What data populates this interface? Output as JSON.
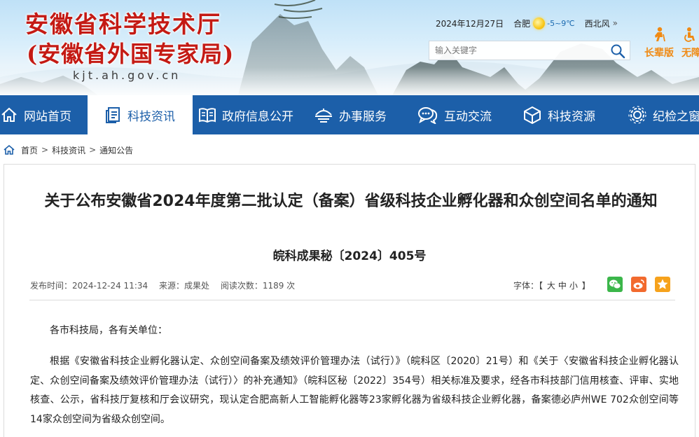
{
  "header": {
    "title": "安徽省科学技术厅",
    "subtitle": "(安徽省外国专家局)",
    "domain": "kjt.ah.gov.cn",
    "date": "2024年12月27日",
    "weather": {
      "city": "合肥",
      "temp": "-5~9℃",
      "wind": "西北风",
      "icon": "sun-icon"
    },
    "search": {
      "placeholder": "输入关键字"
    },
    "care_mode_label": "长辈版",
    "accessibility_label": "无障"
  },
  "nav": {
    "items": [
      {
        "label": "网站首页",
        "icon": "home-icon"
      },
      {
        "label": "科技资讯",
        "icon": "document-icon",
        "active": true
      },
      {
        "label": "政府信息公开",
        "icon": "book-icon"
      },
      {
        "label": "办事服务",
        "icon": "service-icon"
      },
      {
        "label": "互动交流",
        "icon": "chat-icon"
      },
      {
        "label": "科技资源",
        "icon": "cube-icon"
      },
      {
        "label": "纪检之窗",
        "icon": "gear-icon"
      }
    ]
  },
  "breadcrumb": [
    "首页",
    "科技资讯",
    "通知公告"
  ],
  "article": {
    "title": "关于公布安徽省2024年度第二批认定（备案）省级科技企业孵化器和众创空间名单的通知",
    "doc_number": "皖科成果秘〔2024〕405号",
    "publish_time": "发布时间：2024-12-24 11:34",
    "source": "来源：成果处",
    "views": "阅读次数：1189 次",
    "font_size_label": "字体：",
    "font_sizes": [
      "大",
      "中",
      "小"
    ],
    "greeting": "各市科技局，各有关单位：",
    "body": "根据《安徽省科技企业孵化器认定、众创空间备案及绩效评价管理办法（试行）》（皖科区〔2020〕21号）和《关于〈安徽省科技企业孵化器认定、众创空间备案及绩效评价管理办法（试行）〉的补充通知》（皖科区秘〔2022〕354号）相关标准及要求，经各市科技部门信用核查、评审、实地核查、公示，省科技厅复核和厅会议研究，现认定合肥高新人工智能孵化器等23家孵化器为省级科技企业孵化器，备案德必庐州WE 702众创空间等14家众创空间为省级众创空间。"
  },
  "colors": {
    "brand_red": "#c41a14",
    "nav_blue": "#1c5fa9",
    "accent_orange": "#f08a14",
    "wechat_green": "#3bb64a",
    "weibo_orange": "#f26a2e",
    "qzone_orange": "#f6a21c"
  }
}
